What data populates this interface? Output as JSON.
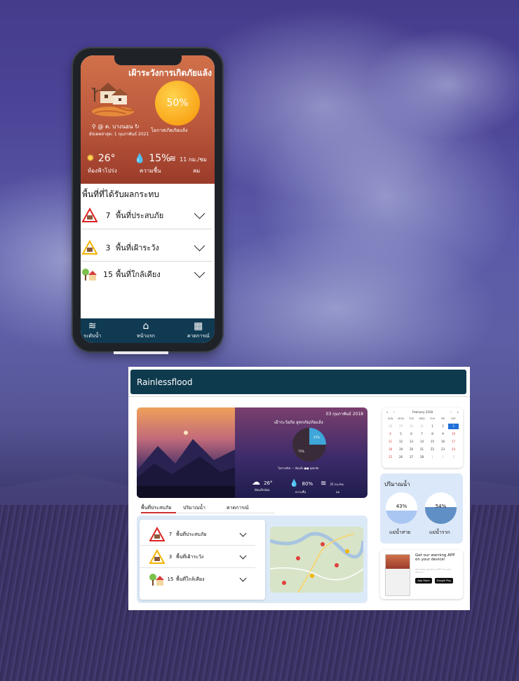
{
  "phone": {
    "title": "เฝ้าระวังการเกิดภัยแล้ง",
    "chance_value": "50%",
    "chance_caption": "โอกาสเกิดภัยแล้ง",
    "location": "@ ต. บางนอน",
    "updated": "อัปเดตล่าสุด: 1 กุมภาพันธ์ 2021",
    "weather": [
      {
        "icon": "sun-icon",
        "value": "26°",
        "label": "ท้องฟ้าโปร่ง"
      },
      {
        "icon": "water-drop-icon",
        "value": "15%",
        "label": "ความชื้น"
      },
      {
        "icon": "wind-icon",
        "value": "11 กม./ชม",
        "label": "ลม"
      }
    ],
    "areas_header": "พื้นที่ที่ได้รับผลกระทบ",
    "areas": [
      {
        "count": "7",
        "label": "พื้นที่ประสบภัย",
        "icon": "warning-red-icon"
      },
      {
        "count": "3",
        "label": "พื้นที่เฝ้าระวัง",
        "icon": "warning-yellow-icon"
      },
      {
        "count": "15",
        "label": "พื้นที่ใกล้เคียง",
        "icon": "house-tree-icon"
      }
    ],
    "nav": [
      {
        "icon": "water-level-icon",
        "label": "ระดับน้ำ"
      },
      {
        "icon": "home-icon",
        "label": "หน้าแรก"
      },
      {
        "icon": "calendar-icon",
        "label": "คาดการณ์"
      }
    ]
  },
  "web": {
    "brand": "Rainlessflood",
    "hero": {
      "date": "03 กุมภาพันธ์ 2018",
      "title": "เฝ้าระวังภัย อุทกภัย/ภัยแล้ง",
      "pie_small": "25%",
      "pie_large": "75%",
      "legend": "โอกาสเกิด ··· ภัยแล้ง ●● อุทกภัย",
      "temp": "26°",
      "temp_label": "มีฝนเล็กน้อย",
      "humidity": "80%",
      "humidity_label": "ความชื้น",
      "wind": "25 กม./ชม",
      "wind_label": "ลม"
    },
    "tabs": [
      "พื้นที่ประสบภัย",
      "ปริมาณน้ำ",
      "คาดการณ์"
    ],
    "areas": [
      {
        "count": "7",
        "label": "พื้นที่ประสบภัย"
      },
      {
        "count": "3",
        "label": "พื้นที่เฝ้าระวัง"
      },
      {
        "count": "15",
        "label": "พื้นที่ใกล้เคียง"
      }
    ],
    "calendar": {
      "month": "February 2018",
      "days": [
        "SUN",
        "MON",
        "TUE",
        "WED",
        "THU",
        "FRI",
        "SAT"
      ],
      "weeks": [
        [
          "28",
          "29",
          "30",
          "31",
          "1",
          "2",
          "3"
        ],
        [
          "4",
          "5",
          "6",
          "7",
          "8",
          "9",
          "10"
        ],
        [
          "11",
          "12",
          "13",
          "14",
          "15",
          "16",
          "17"
        ],
        [
          "18",
          "19",
          "20",
          "21",
          "22",
          "23",
          "24"
        ],
        [
          "25",
          "26",
          "27",
          "28",
          "1",
          "2",
          "3"
        ]
      ]
    },
    "water": {
      "title": "ปริมาณน้ำ",
      "gauges": [
        {
          "name": "แม่น้ำสาย",
          "value": "43%",
          "level": 0.43,
          "color": "#a9c6f2"
        },
        {
          "name": "แม่น้ำรวก",
          "value": "54%",
          "level": 0.54,
          "color": "#5f8fc4"
        }
      ]
    },
    "app_promo": {
      "title": "Get our warning APP on your device!",
      "sub": "Rainless warning APP on your device!",
      "store1": "App Store",
      "store2": "Google Play"
    }
  }
}
